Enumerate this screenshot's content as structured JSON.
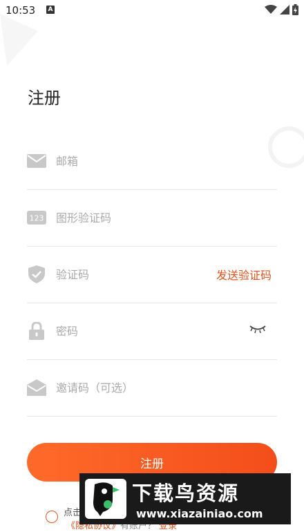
{
  "status_bar": {
    "time": "10:53",
    "notification_letter": "A",
    "icons": [
      "wifi-icon",
      "signal-icon",
      "battery-icon"
    ]
  },
  "page": {
    "title": "注册"
  },
  "form": {
    "email_placeholder": "邮箱",
    "captcha_placeholder": "图形验证码",
    "captcha_icon_text": "123",
    "code_placeholder": "验证码",
    "send_code_label": "发送验证码",
    "password_placeholder": "密码",
    "invite_placeholder": "邀请码（可选）",
    "submit_label": "注册"
  },
  "agreement": {
    "line1": "点击",
    "policy_link": "《隐私协议》",
    "middle": "有账户？",
    "login_label": "登录"
  },
  "watermark": {
    "brand": "下载鸟资源",
    "url": "www.xiazainiao.com"
  },
  "colors": {
    "accent": "#f4561c",
    "icon_gray": "#c8c8c8",
    "divider": "#e6e6e6",
    "placeholder": "#aaaaaa"
  }
}
